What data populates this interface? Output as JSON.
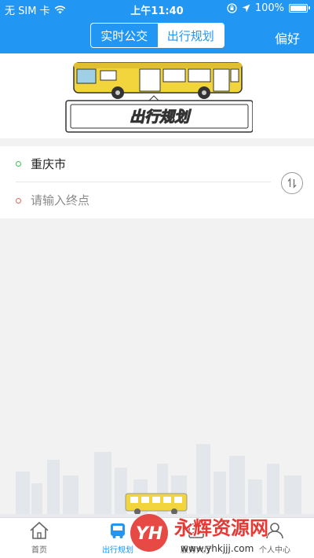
{
  "status_bar": {
    "carrier": "无 SIM 卡",
    "time": "上午11:40",
    "battery": "100%"
  },
  "header": {
    "tabs": [
      {
        "label": "实时公交",
        "active": false
      },
      {
        "label": "出行规划",
        "active": true
      }
    ],
    "preference": "偏好"
  },
  "banner": {
    "sign_text": "出行规划"
  },
  "route_form": {
    "origin": "重庆市",
    "destination_value": "",
    "destination_placeholder": "请输入终点"
  },
  "tabbar": {
    "items": [
      {
        "label": "首页",
        "icon": "home-icon",
        "active": false
      },
      {
        "label": "出行规划",
        "icon": "bus-icon",
        "active": true
      },
      {
        "label": "服务大厅",
        "icon": "service-icon",
        "active": false
      },
      {
        "label": "个人中心",
        "icon": "person-icon",
        "active": false
      }
    ]
  },
  "watermark": {
    "logo": "YH",
    "name": "永辉资源网",
    "url": "www.yhkjjj.com"
  },
  "colors": {
    "primary": "#2196f3",
    "origin_dot": "#3fbf5a",
    "destination_dot": "#e06c5c",
    "background": "#f2f2f2"
  }
}
